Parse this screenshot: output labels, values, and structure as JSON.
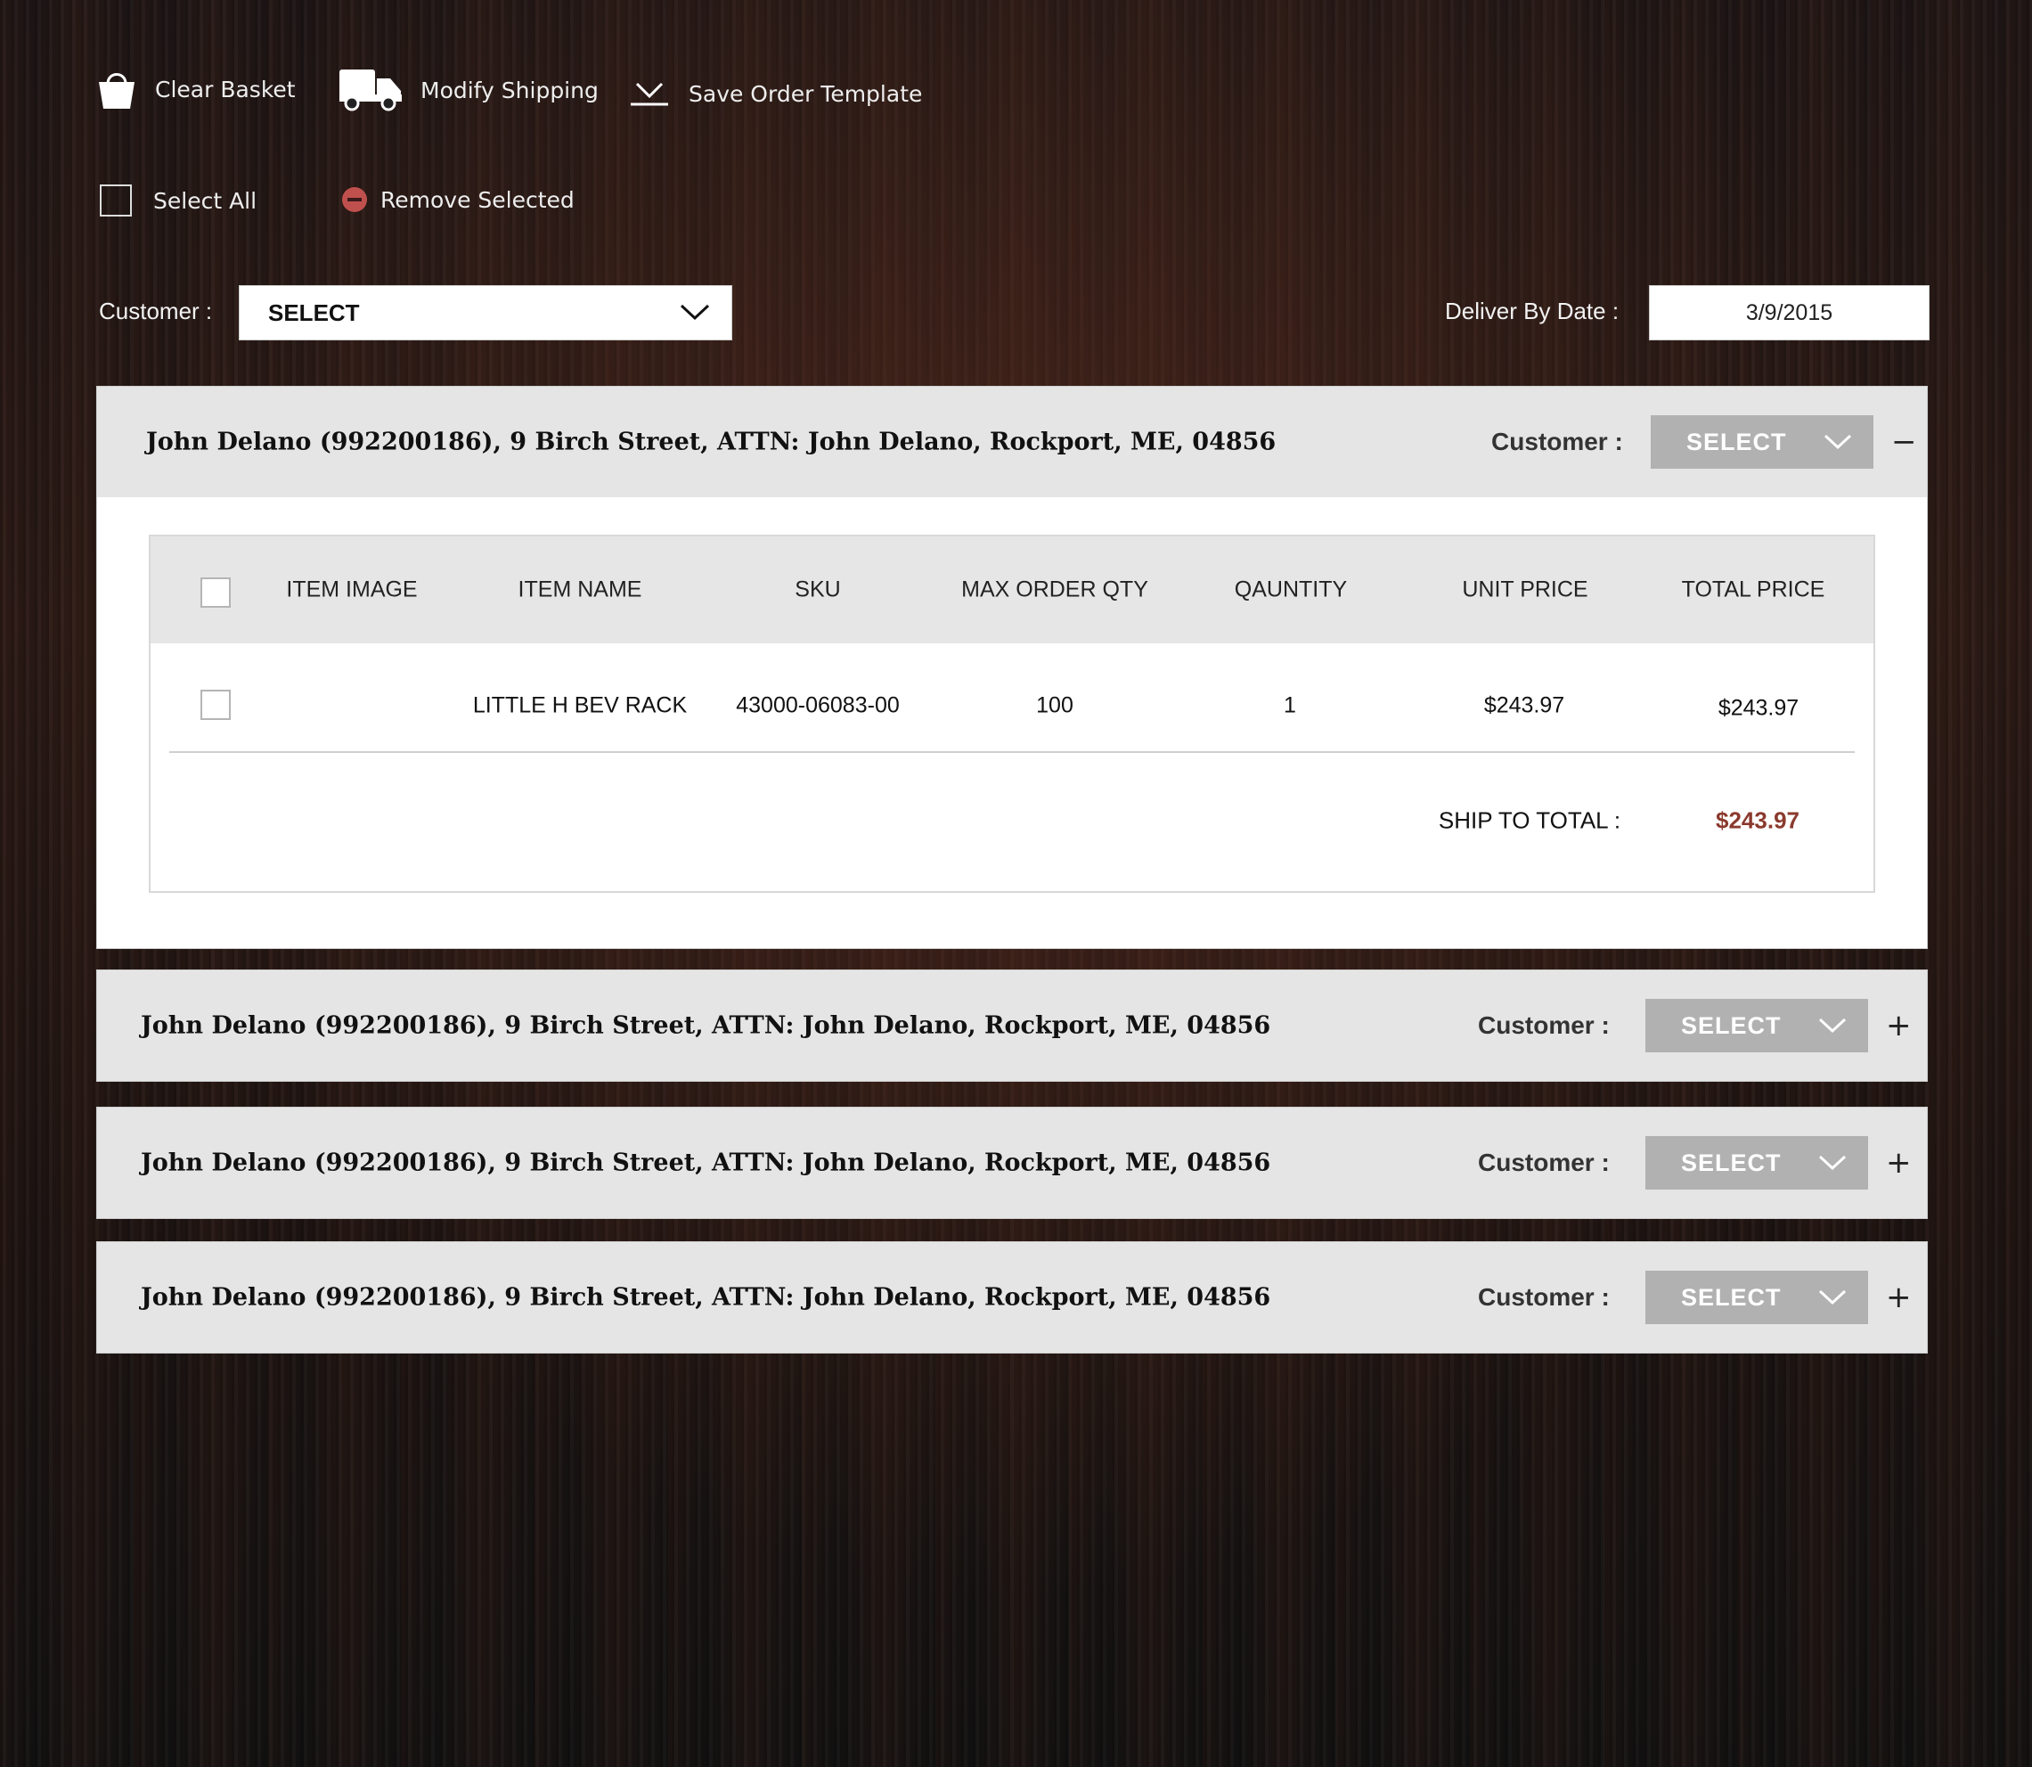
{
  "toolbar": {
    "clear_basket": "Clear Basket",
    "modify_shipping": "Modify Shipping",
    "save_template": "Save Order Template",
    "select_all": "Select All",
    "remove_selected": "Remove Selected"
  },
  "filters": {
    "customer_label": "Customer :",
    "customer_value": "SELECT",
    "deliver_label": "Deliver By Date :",
    "deliver_value": "3/9/2015"
  },
  "colors": {
    "remove_icon": "#c0504d",
    "total_accent": "#8b3a2e",
    "panel_select": "#b1b1b1"
  },
  "table": {
    "headers": [
      "ITEM IMAGE",
      "ITEM NAME",
      "SKU",
      "MAX ORDER QTY",
      "QAUNTITY",
      "UNIT PRICE",
      "TOTAL PRICE"
    ],
    "row": {
      "item_name": "LITTLE H BEV RACK",
      "sku": "43000-06083-00",
      "max_qty": "100",
      "quantity": "1",
      "unit_price": "$243.97",
      "total_price": "$243.97"
    },
    "ship_total_label": "SHIP TO TOTAL :",
    "ship_total_value": "$243.97"
  },
  "panels": [
    {
      "title": "John Delano (992200186), 9 Birch Street, ATTN: John Delano, Rockport, ME, 04856",
      "customer_label": "Customer :",
      "select": "SELECT",
      "toggle": "−",
      "expanded": true
    },
    {
      "title": "John Delano (992200186), 9 Birch Street, ATTN: John Delano, Rockport, ME, 04856",
      "customer_label": "Customer :",
      "select": "SELECT",
      "toggle": "+",
      "expanded": false
    },
    {
      "title": "John Delano (992200186), 9 Birch Street, ATTN: John Delano, Rockport, ME, 04856",
      "customer_label": "Customer :",
      "select": "SELECT",
      "toggle": "+",
      "expanded": false
    },
    {
      "title": "John Delano (992200186), 9 Birch Street, ATTN: John Delano, Rockport, ME, 04856",
      "customer_label": "Customer :",
      "select": "SELECT",
      "toggle": "+",
      "expanded": false
    }
  ]
}
